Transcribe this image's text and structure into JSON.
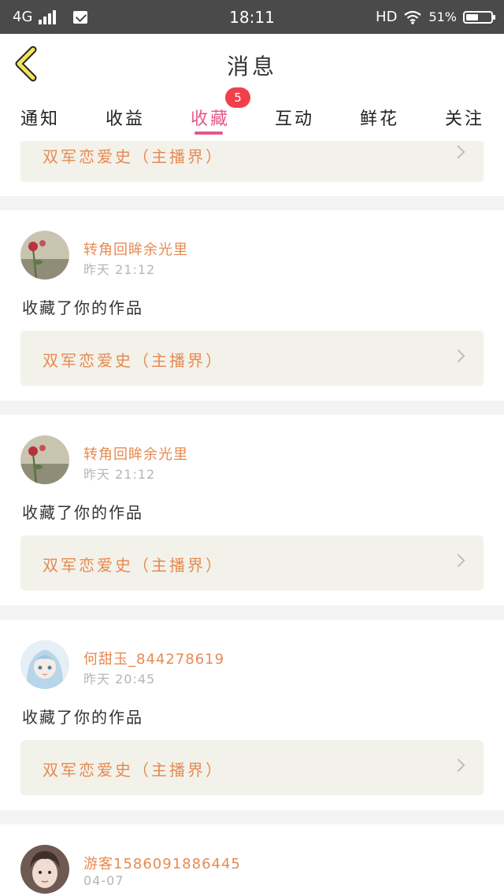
{
  "status_bar": {
    "network": "4G",
    "time": "18:11",
    "hd": "HD",
    "battery": "51%",
    "battery_level": 0.51
  },
  "header": {
    "title": "消息"
  },
  "tabs": [
    {
      "label": "通知"
    },
    {
      "label": "收益"
    },
    {
      "label": "收藏",
      "active": true,
      "badge": "5"
    },
    {
      "label": "互动"
    },
    {
      "label": "鲜花"
    },
    {
      "label": "关注"
    }
  ],
  "cards": [
    {
      "work_title": "双军恋爱史（主播界）"
    },
    {
      "username": "转角回眸余光里",
      "time": "昨天 21:12",
      "message": "收藏了你的作品",
      "work_title": "双军恋爱史（主播界）"
    },
    {
      "username": "转角回眸余光里",
      "time": "昨天 21:12",
      "message": "收藏了你的作品",
      "work_title": "双军恋爱史（主播界）"
    },
    {
      "username": "何甜玉_844278619",
      "time": "昨天 20:45",
      "message": "收藏了你的作品",
      "work_title": "双军恋爱史（主播界）"
    },
    {
      "username": "游客1586091886445",
      "time": "04-07"
    }
  ],
  "colors": {
    "accent_pink": "#e5588b",
    "badge_red": "#f0414a",
    "name_orange": "#e78a53",
    "status_bar_bg": "#4a4a4a",
    "work_box_bg": "#f3f2ea"
  }
}
